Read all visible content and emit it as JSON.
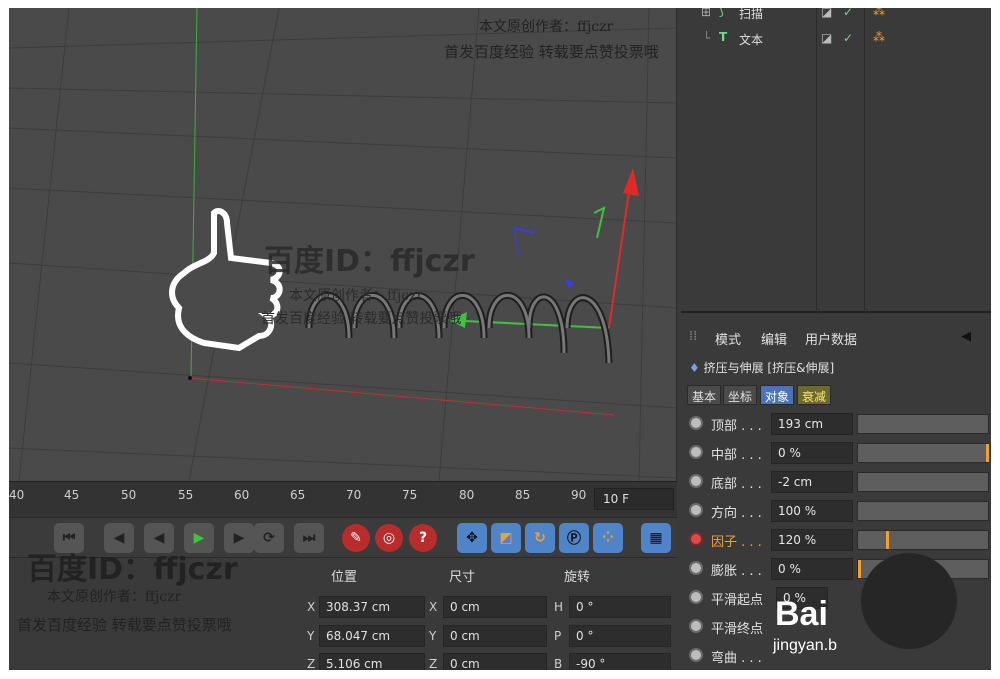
{
  "timeline": {
    "frames": [
      "40",
      "45",
      "50",
      "55",
      "60",
      "65",
      "70",
      "75",
      "80",
      "85",
      "90"
    ],
    "current_frame": "10 F"
  },
  "coordinates": {
    "headers": [
      "位置",
      "尺寸",
      "旋转"
    ],
    "rows": [
      {
        "axis1": "X",
        "position": "308.37 cm",
        "axis2": "X",
        "size": "0 cm",
        "axis3": "H",
        "rotation": "0 °"
      },
      {
        "axis1": "Y",
        "position": "68.047 cm",
        "axis2": "Y",
        "size": "0 cm",
        "axis3": "P",
        "rotation": "0 °"
      },
      {
        "axis1": "Z",
        "position": "5.106 cm",
        "axis2": "Z",
        "size": "0 cm",
        "axis3": "B",
        "rotation": "-90 °"
      }
    ]
  },
  "object_manager": {
    "items": [
      {
        "name": "扫描"
      },
      {
        "name": "文本"
      }
    ]
  },
  "attributes": {
    "menu": [
      "模式",
      "编辑",
      "用户数据"
    ],
    "title": "挤压与伸展 [挤压&伸展]",
    "tabs": [
      "基本",
      "坐标",
      "对象",
      "衰减"
    ],
    "params": [
      {
        "label": "顶部 . . .",
        "value": "193 cm",
        "fill": 0.0
      },
      {
        "label": "中部 . . .",
        "value": "0 %",
        "fill": 1.0
      },
      {
        "label": "底部 . . .",
        "value": "-2 cm",
        "fill": 0.0
      },
      {
        "label": "方向 . . .",
        "value": "100 %",
        "fill": 0.0
      },
      {
        "label": "因子 . . .",
        "value": "120 %",
        "fill": 0.22
      },
      {
        "label": "膨胀 . . .",
        "value": "0 %",
        "fill": 0.0
      },
      {
        "label": "平滑起点",
        "value": "0 %",
        "fill": 0.0
      },
      {
        "label": "平滑终点",
        "value": "",
        "fill": 0.0
      },
      {
        "label": "弯曲 . . .",
        "value": "",
        "fill": 0.0
      }
    ]
  },
  "watermarks": {
    "viewport_big": "百度ID：ffjczr",
    "author": "本文原创作者：ffjczr",
    "share": "首发百度经验 转载要点赞投票哦",
    "top_author": "本文原创作者：ffjczr",
    "top_share": "首发百度经验 转载要点赞投票哦",
    "bottom_big": "百度ID：ffjczr",
    "bottom_author": "本文原创作者：ffjczr",
    "bottom_share": "首发百度经验 转载要点赞投票哦",
    "logo": "Bai",
    "logo_sub": "jingyan.b"
  }
}
